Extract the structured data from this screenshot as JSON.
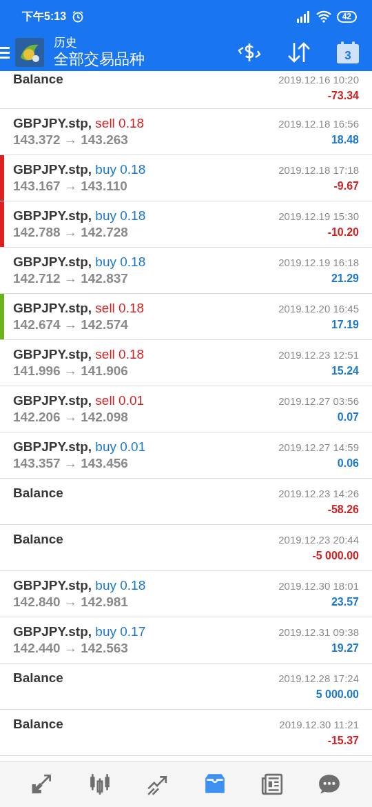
{
  "status_bar": {
    "time": "下午5:13",
    "battery": "42"
  },
  "app_bar": {
    "title": "历史",
    "subtitle": "全部交易品种",
    "calendar_day": "3"
  },
  "rows": [
    {
      "kind": "balance",
      "title": "Balance",
      "time": "2019.12.16 10:20",
      "profit": "-73.34",
      "loss": true
    },
    {
      "kind": "trade",
      "symbol": "GBPJPY.stp,",
      "order": {
        "kind": "sell",
        "text": "sell 0.18"
      },
      "prices": "143.372 → 143.263",
      "time": "2019.12.18 16:56",
      "profit": "18.48",
      "loss": false
    },
    {
      "kind": "trade",
      "symbol": "GBPJPY.stp,",
      "order": {
        "kind": "buy",
        "text": "buy 0.18"
      },
      "prices": "143.167 → 143.110",
      "time": "2019.12.18 17:18",
      "profit": "-9.67",
      "loss": true,
      "color": "#e02020"
    },
    {
      "kind": "trade",
      "symbol": "GBPJPY.stp,",
      "order": {
        "kind": "buy",
        "text": "buy 0.18"
      },
      "prices": "142.788 → 142.728",
      "time": "2019.12.19 15:30",
      "profit": "-10.20",
      "loss": true,
      "color": "#e02020"
    },
    {
      "kind": "trade",
      "symbol": "GBPJPY.stp,",
      "order": {
        "kind": "buy",
        "text": "buy 0.18"
      },
      "prices": "142.712 → 142.837",
      "time": "2019.12.19 16:18",
      "profit": "21.29",
      "loss": false
    },
    {
      "kind": "trade",
      "symbol": "GBPJPY.stp,",
      "order": {
        "kind": "sell",
        "text": "sell 0.18"
      },
      "prices": "142.674 → 142.574",
      "time": "2019.12.20 16:45",
      "profit": "17.19",
      "loss": false,
      "color": "#6cb21a"
    },
    {
      "kind": "trade",
      "symbol": "GBPJPY.stp,",
      "order": {
        "kind": "sell",
        "text": "sell 0.18"
      },
      "prices": "141.996 → 141.906",
      "time": "2019.12.23 12:51",
      "profit": "15.24",
      "loss": false
    },
    {
      "kind": "trade",
      "symbol": "GBPJPY.stp,",
      "order": {
        "kind": "sell",
        "text": "sell 0.01"
      },
      "prices": "142.206 → 142.098",
      "time": "2019.12.27 03:56",
      "profit": "0.07",
      "loss": false
    },
    {
      "kind": "trade",
      "symbol": "GBPJPY.stp,",
      "order": {
        "kind": "buy",
        "text": "buy 0.01"
      },
      "prices": "143.357 → 143.456",
      "time": "2019.12.27 14:59",
      "profit": "0.06",
      "loss": false
    },
    {
      "kind": "balance",
      "title": "Balance",
      "time": "2019.12.23 14:26",
      "profit": "-58.26",
      "loss": true
    },
    {
      "kind": "balance",
      "title": "Balance",
      "time": "2019.12.23 20:44",
      "profit": "-5 000.00",
      "loss": true
    },
    {
      "kind": "trade",
      "symbol": "GBPJPY.stp,",
      "order": {
        "kind": "buy",
        "text": "buy 0.18"
      },
      "prices": "142.840 → 142.981",
      "time": "2019.12.30 18:01",
      "profit": "23.57",
      "loss": false
    },
    {
      "kind": "trade",
      "symbol": "GBPJPY.stp,",
      "order": {
        "kind": "buy",
        "text": "buy 0.17"
      },
      "prices": "142.440 → 142.563",
      "time": "2019.12.31 09:38",
      "profit": "19.27",
      "loss": false
    },
    {
      "kind": "balance",
      "title": "Balance",
      "time": "2019.12.28 17:24",
      "profit": "5 000.00",
      "loss": false
    },
    {
      "kind": "balance",
      "title": "Balance",
      "time": "2019.12.30 11:21",
      "profit": "-15.37",
      "loss": true
    }
  ],
  "nav": [
    {
      "selected": false
    },
    {
      "selected": false
    },
    {
      "selected": false
    },
    {
      "selected": true
    },
    {
      "selected": false
    },
    {
      "selected": false
    }
  ]
}
